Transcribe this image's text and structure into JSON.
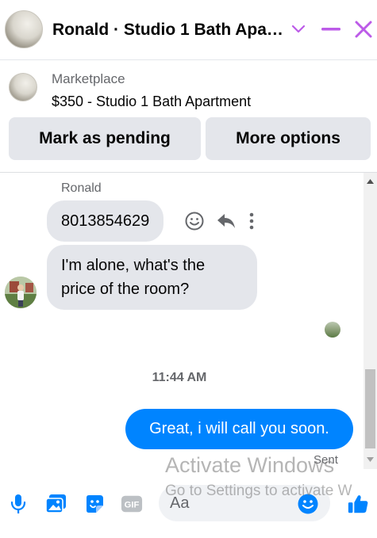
{
  "header": {
    "title": "Ronald · Studio 1 Bath Apa…",
    "accent_color": "#bc5be8"
  },
  "listing": {
    "category": "Marketplace",
    "title": "$350 - Studio 1 Bath Apartment",
    "mark_pending_label": "Mark as pending",
    "more_options_label": "More options"
  },
  "chat": {
    "sender_name": "Ronald",
    "messages_in": [
      {
        "text": "8013854629"
      },
      {
        "line1": "I'm alone, what's the",
        "line2": "price of the room?"
      }
    ],
    "timestamp": "11:44 AM",
    "message_out": "Great, i will call you soon.",
    "sent_label": "Sent",
    "outgoing_color": "#0084ff"
  },
  "composer": {
    "placeholder": "Aa",
    "icons": [
      "microphone-icon",
      "photo-icon",
      "sticker-icon",
      "gif-icon",
      "emoji-icon",
      "like-icon"
    ],
    "gif_label": "GIF",
    "icon_color": "#0084ff"
  },
  "watermark": {
    "title": "Activate Windows",
    "subtitle": "Go to Settings to activate W"
  }
}
